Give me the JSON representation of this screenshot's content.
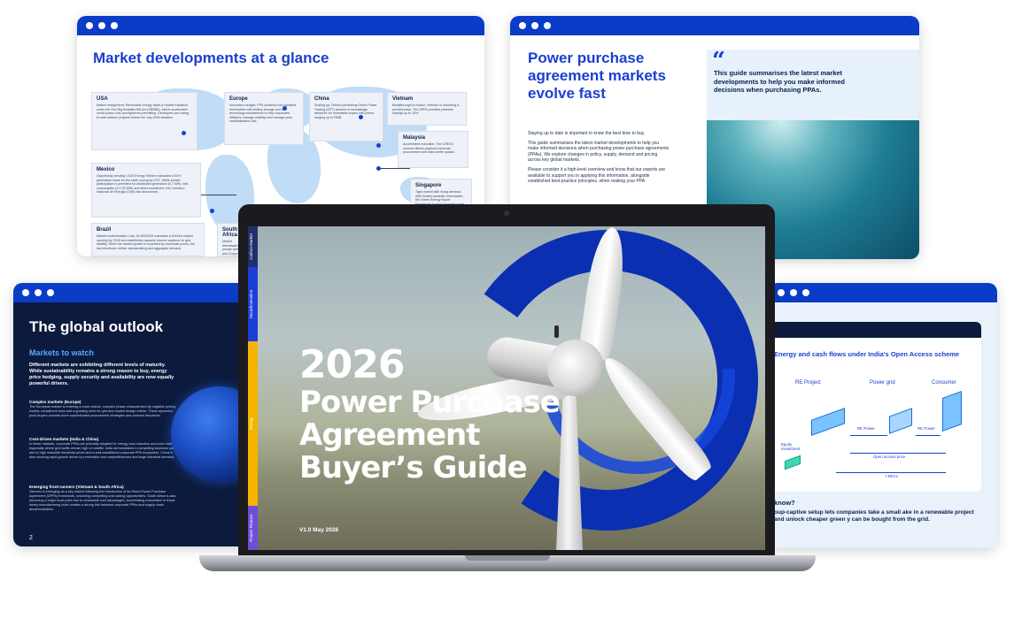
{
  "window_market": {
    "title": "Market developments at a glance",
    "regions": [
      {
        "name": "USA",
        "desc": "Market realignment: Renewable energy faces a volatile transition under the One Big Beautiful Bill Act (OBBBA), which accelerated credit phase-outs and tightened permitting. Developers are racing to safe-harbour projects before the July 2026 deadline."
      },
      {
        "name": "Europe",
        "desc": "Innovation hedges: PPA solutions now combine renewables with battery storage and co-technology mechanisms to help corporates offtakers manage volatility and manage price cannibalisation risk."
      },
      {
        "name": "China",
        "desc": "Scaling up: China's pioneering Green Power Trading (GPT) scheme is increasingly attractive for renewable buyers with prices ranging up to RMB."
      },
      {
        "name": "Vietnam",
        "desc": "Breakthrough in motion: Vietnam is unlocking a pivotal phase. The DPPA provides potential savings up to 15%."
      },
      {
        "name": "Malaysia",
        "desc": "Accelerated execution: The CRESS scheme allows physical corporate procurement and data centre uptake."
      },
      {
        "name": "Mexico",
        "desc": "Opportunity pending: 2025 Energy Reform mandates a 54% generation share for the state monopoly CFE. While private participation is permitted for distributed generation (0.7 MW), self-consumption (0.7-20 MW) and direct investment, the Comision Nacional de Energia (CNE) has announced."
      },
      {
        "name": "Singapore",
        "desc": "Tight market with rising demand: With limited domestic renewables, the Green Energy Import Framework is set to broaden cross-border PPA deals."
      },
      {
        "name": "Brazil",
        "desc": "Market modernisation: Law 15,269/2025 mandates a full free-market opening by 2028 and establishes capacity reserve auctions for grid stability. While the market growth is expected by wholesale prices, the law introduces stricter standardising and aggregate demand."
      },
      {
        "name": "South Africa",
        "desc": "Market liberalisation: private wheeling and Corporate demand storage and wheeling constraints."
      }
    ]
  },
  "window_ppa": {
    "title": "Power purchase agreement markets evolve fast",
    "quote": "This guide summarises the latest market developments to help you make informed decisions when purchasing PPAs.",
    "quote_mark": "“",
    "paragraphs": [
      "Staying up to date is important to know the best time to buy.",
      "This guide summarises the latest market developments to help you make informed decisions when purchasing power purchase agreements (PPAs). We explore changes in policy, supply, demand and pricing across key global markets.",
      "Please consider it a high-level overview and know that our experts are available to support you in applying this information, alongside established best-practice principles, when making your PPA"
    ]
  },
  "window_outlook": {
    "title": "The global outlook",
    "subtitle": "Markets to watch",
    "lead": "Different markets are exhibiting different levels of maturity. While sustainability remains a strong reason to buy, energy price hedging, supply security and availability are now equally powerful drivers.",
    "sections": [
      {
        "title": "Complex markets (Europe)",
        "desc": "The European market is entering a more mature, complex phase characterised by negative pricing events, curtailment risks and a growing need for grid and market design reform. These dynamics push buyers towards more sophisticated procurement strategies and contract structures."
      },
      {
        "title": "Cost-driven markets (India & China)",
        "desc": "In these markets, corporate PPAs are primarily adopted for energy cost reduction and price stability, especially where grid tariffs remain high or volatile. India demonstrates a compelling business case due to high industrial electricity prices and a well-established corporate PPA ecosystem. China is also showing rapid growth driven by renewable cost competitiveness and large industrial demand."
      },
      {
        "title": "Emerging front-runners (Vietnam & South Africa)",
        "desc": "Vietnam is emerging as a key market following the introduction of its Direct Power Purchase Agreement (DPPA) framework, unlocking compelling cost saving opportunities. South Africa is also becoming a major focal point due to renewable cost advantages. Accelerating momentum in these heavy manufacturing hubs creates a strong link between corporate PPAs and supply chain decarbonisation."
      }
    ],
    "page_number": "2"
  },
  "window_india": {
    "chart_title": "Energy and cash flows under India's Open Access scheme",
    "nodes": [
      "RE Project",
      "Power grid",
      "Consumer"
    ],
    "equity_label": "Equity investment",
    "flow_labels": [
      "RE Power",
      "RE Power",
      "Open access price",
      "I-RECs"
    ],
    "know_title": "know?",
    "know_desc": "oup-captive setup lets companies take a small ake in a renewable project and unlock cheaper green y can be bought from the grid."
  },
  "laptop": {
    "tabs": [
      "Carbon Market",
      "Decarbonisation",
      "Energy",
      "Project Finance"
    ],
    "tab_colors": [
      "#1f2f6b",
      "#1b3fd6",
      "#f4b400",
      "#6d4ed8"
    ],
    "cover_year": "2026",
    "cover_lines": [
      "Power Purchase",
      "Agreement",
      "Buyer’s Guide"
    ],
    "version": "V1.0 May 2026"
  },
  "colors": {
    "accent": "#1a3fd1",
    "window_bar": "#0a3cc8",
    "navy": "#0c1b3d",
    "light_blue": "#e6f1fb"
  }
}
